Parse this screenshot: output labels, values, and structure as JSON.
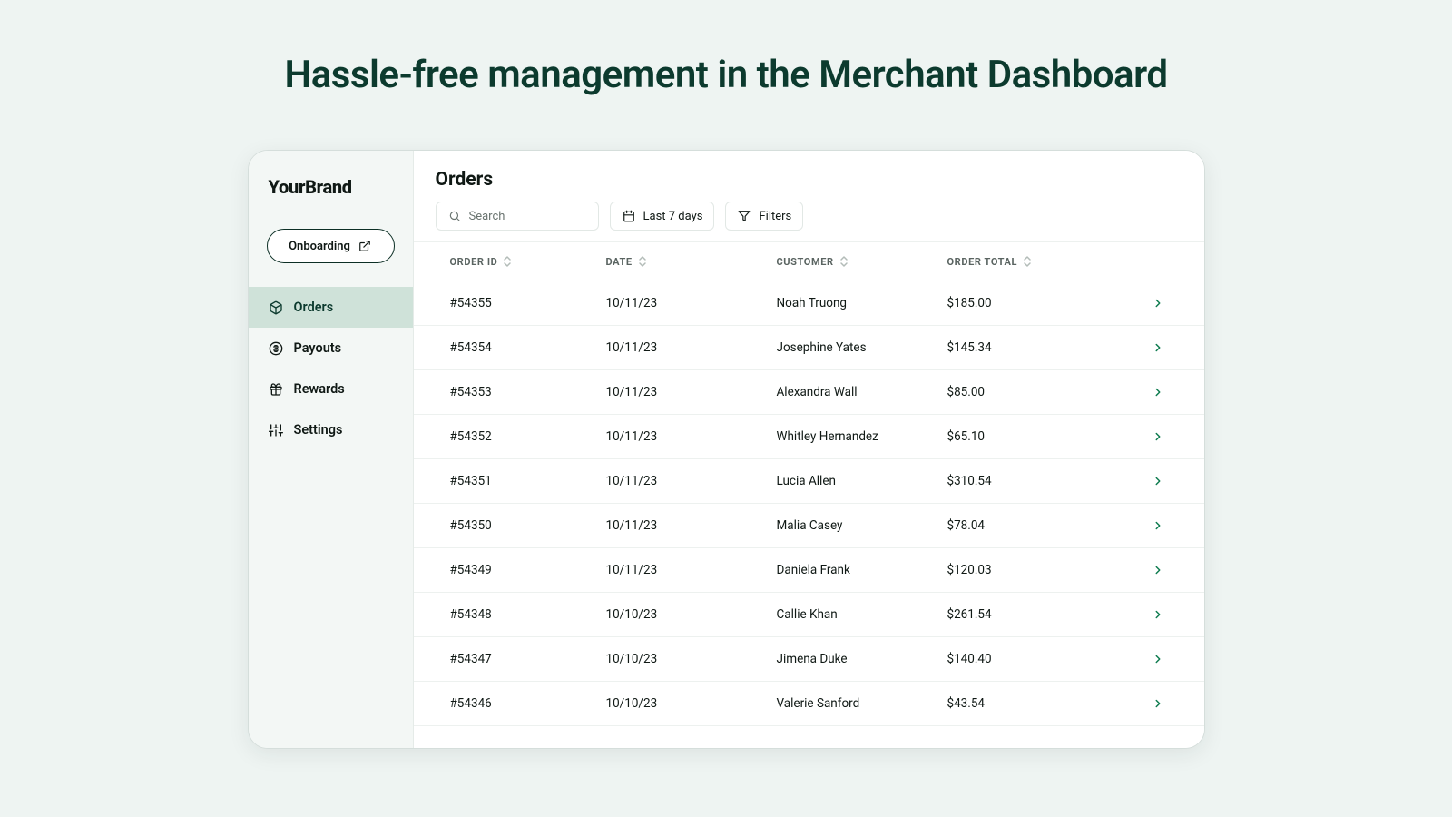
{
  "hero": {
    "title": "Hassle-free management in the Merchant Dashboard"
  },
  "brand": "YourBrand",
  "sidebar": {
    "onboarding_label": "Onboarding",
    "items": [
      {
        "label": "Orders",
        "icon": "package-icon",
        "active": true
      },
      {
        "label": "Payouts",
        "icon": "dollar-icon",
        "active": false
      },
      {
        "label": "Rewards",
        "icon": "gift-icon",
        "active": false
      },
      {
        "label": "Settings",
        "icon": "sliders-icon",
        "active": false
      }
    ]
  },
  "page": {
    "title": "Orders"
  },
  "toolbar": {
    "search_placeholder": "Search",
    "date_filter_label": "Last 7 days",
    "filters_label": "Filters"
  },
  "table": {
    "columns": [
      "ORDER ID",
      "DATE",
      "CUSTOMER",
      "ORDER TOTAL"
    ],
    "rows": [
      {
        "id": "#54355",
        "date": "10/11/23",
        "customer": "Noah Truong",
        "total": "$185.00"
      },
      {
        "id": "#54354",
        "date": "10/11/23",
        "customer": "Josephine Yates",
        "total": "$145.34"
      },
      {
        "id": "#54353",
        "date": "10/11/23",
        "customer": "Alexandra Wall",
        "total": "$85.00"
      },
      {
        "id": "#54352",
        "date": "10/11/23",
        "customer": "Whitley Hernandez",
        "total": "$65.10"
      },
      {
        "id": "#54351",
        "date": "10/11/23",
        "customer": "Lucia Allen",
        "total": "$310.54"
      },
      {
        "id": "#54350",
        "date": "10/11/23",
        "customer": "Malia Casey",
        "total": "$78.04"
      },
      {
        "id": "#54349",
        "date": "10/11/23",
        "customer": "Daniela Frank",
        "total": "$120.03"
      },
      {
        "id": "#54348",
        "date": "10/10/23",
        "customer": "Callie Khan",
        "total": "$261.54"
      },
      {
        "id": "#54347",
        "date": "10/10/23",
        "customer": "Jimena Duke",
        "total": "$140.40"
      },
      {
        "id": "#54346",
        "date": "10/10/23",
        "customer": "Valerie Sanford",
        "total": "$43.54"
      }
    ]
  },
  "colors": {
    "accent": "#0c3a2e",
    "active_bg": "#cfe2d9",
    "arrow": "#0c7a4e"
  }
}
